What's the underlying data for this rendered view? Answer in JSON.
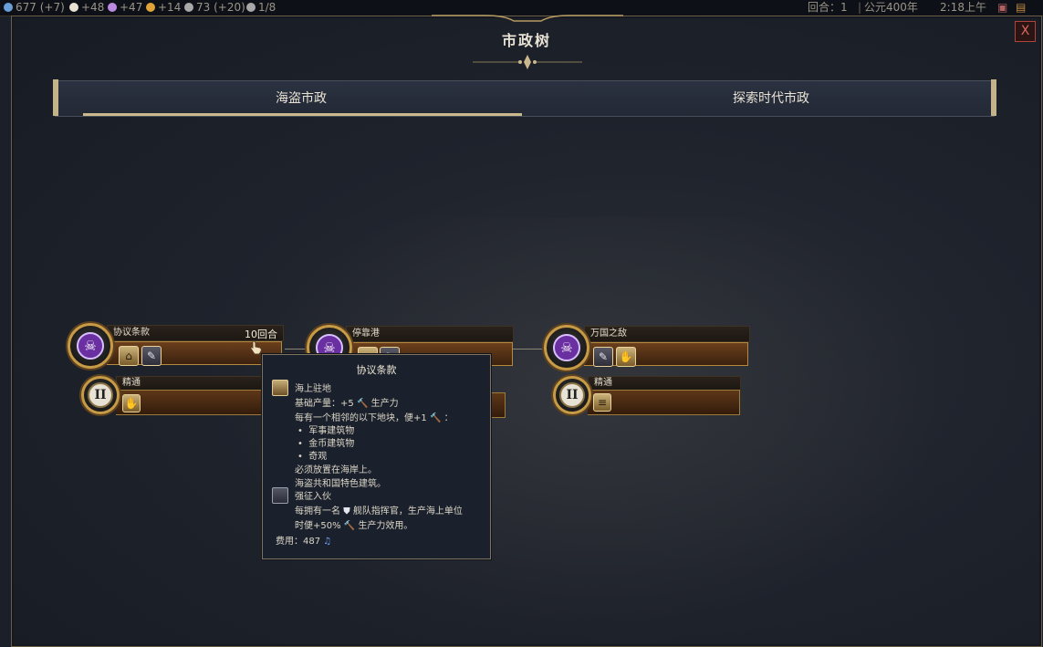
{
  "topbar": {
    "resources": [
      {
        "icon": "science-icon",
        "text": "677 (+7)",
        "color": "#6aa0d8"
      },
      {
        "icon": "faith-icon",
        "text": "+48",
        "color": "#e8e2d4"
      },
      {
        "icon": "culture-icon",
        "text": "+47",
        "color": "#b98ae0"
      },
      {
        "icon": "gold-icon",
        "text": "+14",
        "color": "#e0a33a"
      },
      {
        "icon": "tourism-icon",
        "text": "73 (+20)",
        "color": "#a8a8a8"
      },
      {
        "icon": "great-people-icon",
        "text": "1/8",
        "color": "#a8a8a8"
      }
    ],
    "turn_label": "回合：1",
    "era_year": "公元400年",
    "clock": "2:18上午"
  },
  "panel": {
    "title": "市政树",
    "close_label": "X",
    "tabs": [
      {
        "label": "海盗市政",
        "active": true
      },
      {
        "label": "探索时代市政",
        "active": false
      }
    ]
  },
  "civics": [
    {
      "name": "协议条款",
      "turns": "10回合",
      "icon": "jolly-roger-icon",
      "unlocks": [
        "harbor-building-icon",
        "policy-card-icon"
      ],
      "mastery": {
        "label": "精通",
        "numeral": "II",
        "unlocks": [
          "hand-icon"
        ]
      }
    },
    {
      "name": "停靠港",
      "turns": "",
      "icon": "jolly-roger-icon",
      "unlocks": [
        "harbor-building-icon",
        "policy-card-icon"
      ],
      "mastery": {
        "label": "精通",
        "numeral": "II",
        "unlocks": []
      }
    },
    {
      "name": "万国之敌",
      "turns": "",
      "icon": "jolly-roger-icon",
      "unlocks": [
        "policy-card-icon",
        "hand-icon"
      ],
      "mastery": {
        "label": "精通",
        "numeral": "II",
        "unlocks": [
          "scroll-icon"
        ]
      }
    }
  ],
  "tooltip": {
    "title": "协议条款",
    "building_name": "海上驻地",
    "base_yield": "基础产量：+5",
    "production_word": "生产力",
    "adjacency_intro": "每有一个相邻的以下地块，便+1",
    "bullets": [
      "军事建筑物",
      "金币建筑物",
      "奇观"
    ],
    "placement": "必须放置在海岸上。",
    "unique": "海盗共和国特色建筑。",
    "policy_name": "强征入伙",
    "policy_line1a": "每拥有一名",
    "policy_line1b": "舰队指挥官，生产海上单位",
    "policy_line2a": "时便+50%",
    "policy_line2b": "生产力效用。",
    "cost": "费用：487"
  },
  "colors": {
    "accent_gold": "#c9b98d",
    "civic_purple": "#6a2fa0",
    "culture_note": "#6fa3ff",
    "close_red": "#d9685d"
  }
}
